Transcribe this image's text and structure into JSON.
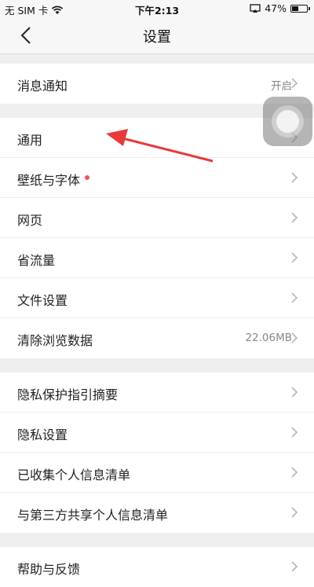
{
  "status_bar": {
    "carrier": "无 SIM 卡",
    "time": "下午2:13",
    "battery_percent": "47%",
    "battery_level": 0.47
  },
  "nav": {
    "title": "设置"
  },
  "groups": [
    {
      "items": [
        {
          "label": "消息通知",
          "value": "开启"
        }
      ]
    },
    {
      "items": [
        {
          "label": "通用"
        },
        {
          "label": "壁纸与字体",
          "badge": true
        },
        {
          "label": "网页"
        },
        {
          "label": "省流量"
        },
        {
          "label": "文件设置"
        },
        {
          "label": "清除浏览数据",
          "value": "22.06MB"
        }
      ]
    },
    {
      "items": [
        {
          "label": "隐私保护指引摘要"
        },
        {
          "label": "隐私设置"
        },
        {
          "label": "已收集个人信息清单"
        },
        {
          "label": "与第三方共享个人信息清单"
        }
      ]
    },
    {
      "items": [
        {
          "label": "帮助与反馈"
        }
      ]
    }
  ],
  "colors": {
    "accent_red": "#f35454",
    "arrow_red": "#e83a3a"
  }
}
